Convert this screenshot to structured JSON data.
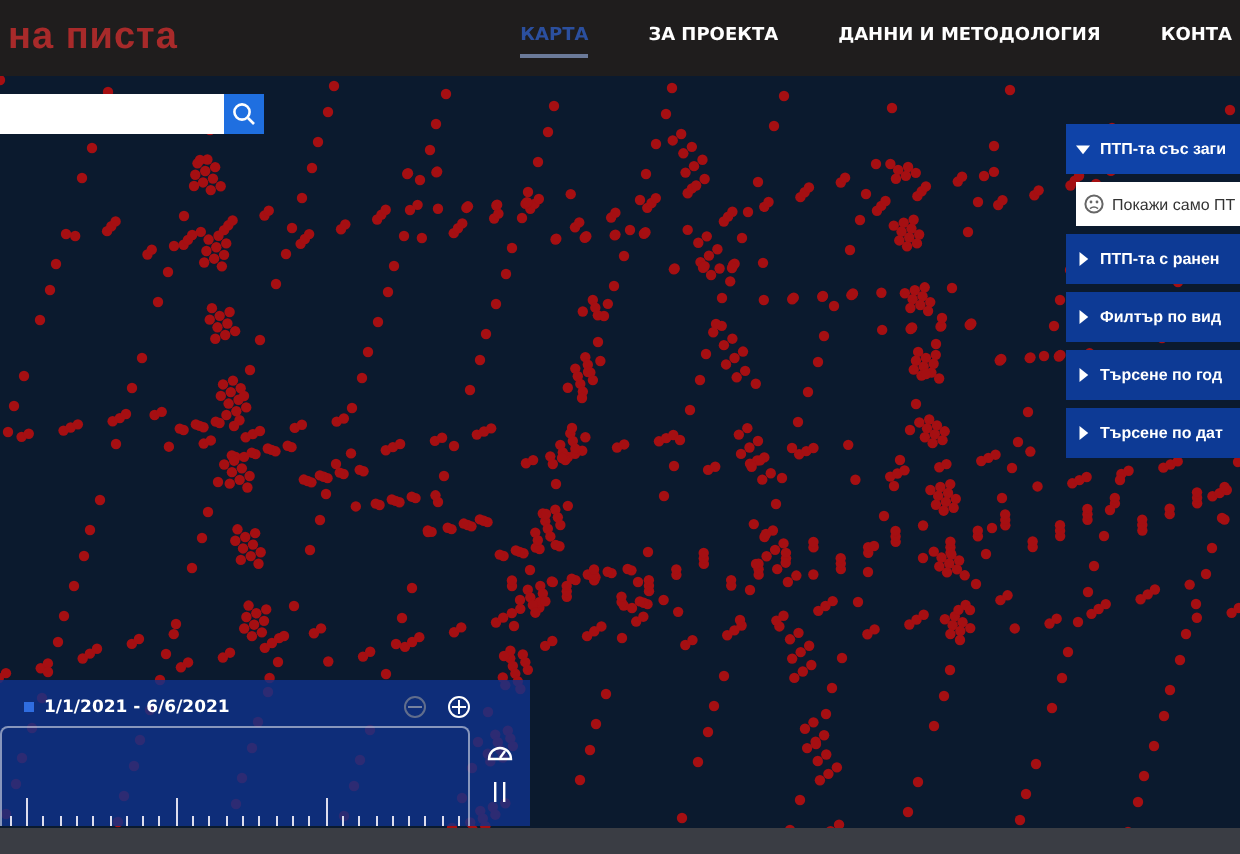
{
  "header": {
    "logo": "на писта",
    "nav": [
      {
        "label": "КАРТА",
        "selected": true
      },
      {
        "label": "ЗА ПРОЕКТА",
        "selected": false
      },
      {
        "label": "ДАННИ И МЕТОДОЛОГИЯ",
        "selected": false
      },
      {
        "label": "КОНТА",
        "selected": false
      }
    ]
  },
  "filters": [
    {
      "title": "ПТП-та със заги",
      "expanded": true,
      "option": "Покажи само ПТ"
    },
    {
      "title": "ПТП-та с ранен",
      "expanded": false
    },
    {
      "title": "Филтър по вид",
      "expanded": false
    },
    {
      "title": "Търсене по год",
      "expanded": false
    },
    {
      "title": "Търсене по дат",
      "expanded": false
    }
  ],
  "timeline": {
    "range": "1/1/2021 - 6/6/2021",
    "playing": true
  }
}
